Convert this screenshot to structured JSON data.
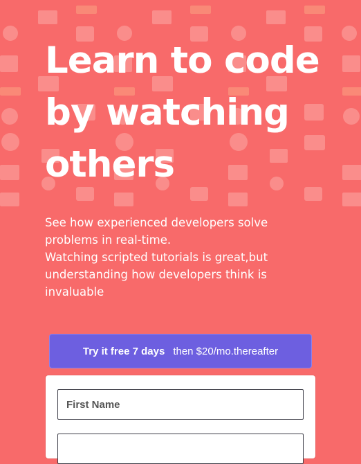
{
  "hero": {
    "title": "Learn to code by watching others",
    "paragraph1": "See how experienced developers solve problems in real-time.",
    "paragraph2": "Watching scripted tutorials is great,but understanding how developers think is invaluable"
  },
  "trial": {
    "strong": "Try it free 7 days",
    "rest": "then $20/mo.thereafter"
  },
  "form": {
    "first_name_placeholder": "First Name",
    "second_field_placeholder": ""
  },
  "colors": {
    "background": "#f86a6a",
    "trial_button": "#6d5fe0",
    "card": "#ffffff"
  },
  "icons": [
    "calendar-icon",
    "headphones-icon",
    "briefcase-icon",
    "monitor-icon",
    "target-icon",
    "lightbulb-icon",
    "tag-icon",
    "chart-icon"
  ]
}
